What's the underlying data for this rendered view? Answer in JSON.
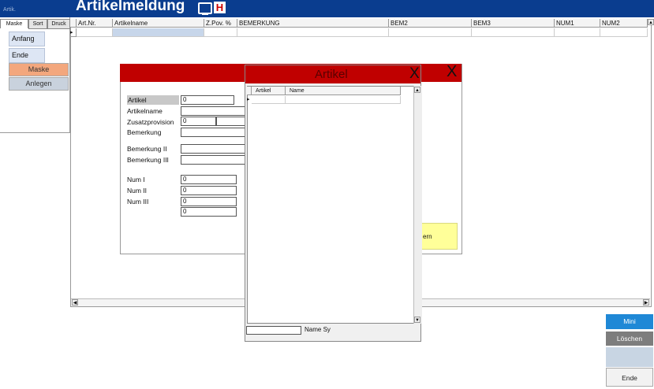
{
  "window": {
    "app_label": "Artik.",
    "title": "Artikelmeldung",
    "h_icon_text": "H"
  },
  "left_panel": {
    "tabs": [
      "Maske",
      "Sort",
      "Druck"
    ],
    "buttons": {
      "anfang": "Anfang",
      "ende": "Ende",
      "maske": "Maske",
      "anlegen": "Anlegen"
    }
  },
  "grid": {
    "columns": [
      "Art.Nr.",
      "Artikelname",
      "Z.Pov. %",
      "BEMERKUNG",
      "BEM2",
      "BEM3",
      "NUM1",
      "NUM2"
    ],
    "row_marker": "▸"
  },
  "form": {
    "close_label": "X",
    "labels": {
      "artikel": "Artikel",
      "artikelname": "Artikelname",
      "zusatzprovision": "Zusatzprovision",
      "bemerkung": "Bemerkung",
      "bemerkung2": "Bemerkung II",
      "bemerkung3": "Bemerkung III",
      "num1": "Num I",
      "num2": "Num II",
      "num3": "Num III"
    },
    "values": {
      "artikel": "0",
      "zusatzprovision": "0",
      "num1": "0",
      "num2": "0",
      "num3": "0",
      "num4": "0"
    },
    "yellow_button_label": "ern"
  },
  "lookup": {
    "title": "Artikel",
    "close_label": "X",
    "columns": [
      "Artikel",
      "Name"
    ],
    "search_label": "Name Sy",
    "search_value": ""
  },
  "right_buttons": {
    "mini": "Mini",
    "loeschen": "Löschen",
    "blank": "",
    "ende": "Ende"
  },
  "colors": {
    "title_bar": "#0a3d8f",
    "dialog_header": "#c00000",
    "mini_button": "#1f88d6"
  }
}
